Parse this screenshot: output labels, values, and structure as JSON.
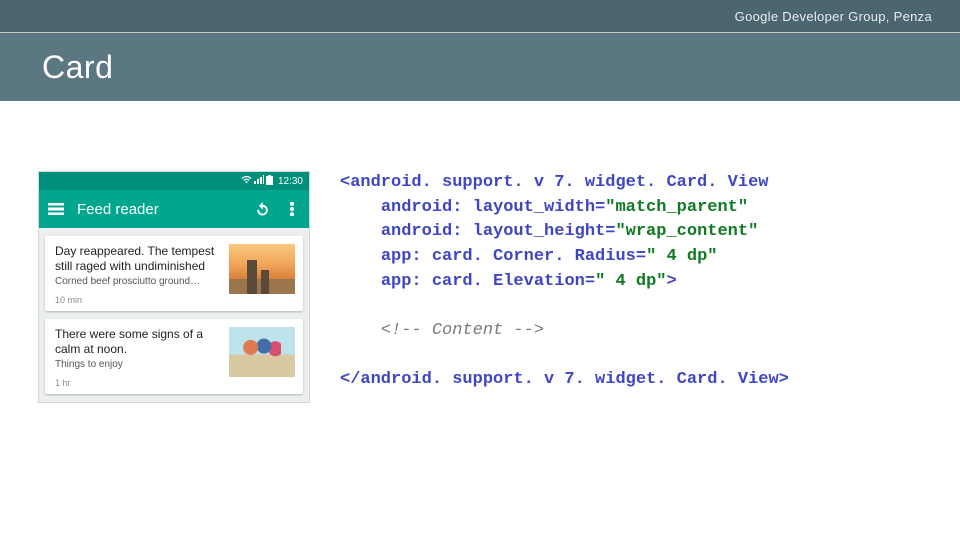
{
  "header": {
    "group": "Google Developer Group, Penza",
    "title": "Card"
  },
  "phone": {
    "clock": "12:30",
    "app_title": "Feed reader",
    "cards": [
      {
        "headline": "Day reappeared. The tempest still raged with undiminished",
        "sub": "Corned beef prosciutto ground…",
        "time": "10 min"
      },
      {
        "headline": "There were some signs of a calm at noon.",
        "sub": "Things to enjoy",
        "time": "1 hr"
      }
    ]
  },
  "code": {
    "open_tag": "<android. support. v 7. widget. Card. View",
    "attr1_name": "android: layout_width=",
    "attr1_val": "\"match_parent\"",
    "attr2_name": "android: layout_height=",
    "attr2_val": "\"wrap_content\"",
    "attr3_name": "app: card. Corner. Radius=",
    "attr3_val": "\" 4 dp\"",
    "attr4_name": "app: card. Elevation=",
    "attr4_val": "\" 4 dp\"",
    "open_end": ">",
    "comment": "<!-- Content -->",
    "close": "</android. support. v 7. widget. Card. View>"
  }
}
